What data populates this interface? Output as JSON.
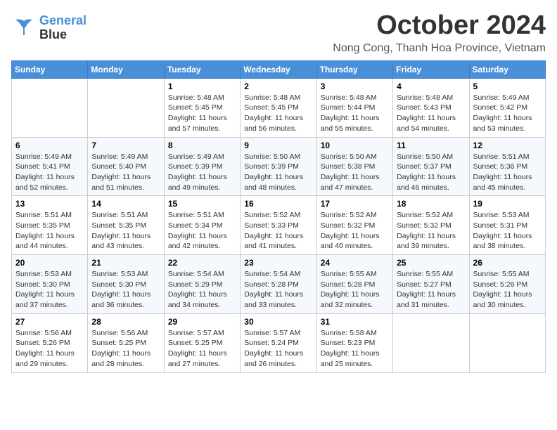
{
  "header": {
    "logo_line1": "General",
    "logo_line2": "Blue",
    "month": "October 2024",
    "location": "Nong Cong, Thanh Hoa Province, Vietnam"
  },
  "weekdays": [
    "Sunday",
    "Monday",
    "Tuesday",
    "Wednesday",
    "Thursday",
    "Friday",
    "Saturday"
  ],
  "weeks": [
    [
      {
        "day": "",
        "info": ""
      },
      {
        "day": "",
        "info": ""
      },
      {
        "day": "1",
        "info": "Sunrise: 5:48 AM\nSunset: 5:45 PM\nDaylight: 11 hours and 57 minutes."
      },
      {
        "day": "2",
        "info": "Sunrise: 5:48 AM\nSunset: 5:45 PM\nDaylight: 11 hours and 56 minutes."
      },
      {
        "day": "3",
        "info": "Sunrise: 5:48 AM\nSunset: 5:44 PM\nDaylight: 11 hours and 55 minutes."
      },
      {
        "day": "4",
        "info": "Sunrise: 5:48 AM\nSunset: 5:43 PM\nDaylight: 11 hours and 54 minutes."
      },
      {
        "day": "5",
        "info": "Sunrise: 5:49 AM\nSunset: 5:42 PM\nDaylight: 11 hours and 53 minutes."
      }
    ],
    [
      {
        "day": "6",
        "info": "Sunrise: 5:49 AM\nSunset: 5:41 PM\nDaylight: 11 hours and 52 minutes."
      },
      {
        "day": "7",
        "info": "Sunrise: 5:49 AM\nSunset: 5:40 PM\nDaylight: 11 hours and 51 minutes."
      },
      {
        "day": "8",
        "info": "Sunrise: 5:49 AM\nSunset: 5:39 PM\nDaylight: 11 hours and 49 minutes."
      },
      {
        "day": "9",
        "info": "Sunrise: 5:50 AM\nSunset: 5:39 PM\nDaylight: 11 hours and 48 minutes."
      },
      {
        "day": "10",
        "info": "Sunrise: 5:50 AM\nSunset: 5:38 PM\nDaylight: 11 hours and 47 minutes."
      },
      {
        "day": "11",
        "info": "Sunrise: 5:50 AM\nSunset: 5:37 PM\nDaylight: 11 hours and 46 minutes."
      },
      {
        "day": "12",
        "info": "Sunrise: 5:51 AM\nSunset: 5:36 PM\nDaylight: 11 hours and 45 minutes."
      }
    ],
    [
      {
        "day": "13",
        "info": "Sunrise: 5:51 AM\nSunset: 5:35 PM\nDaylight: 11 hours and 44 minutes."
      },
      {
        "day": "14",
        "info": "Sunrise: 5:51 AM\nSunset: 5:35 PM\nDaylight: 11 hours and 43 minutes."
      },
      {
        "day": "15",
        "info": "Sunrise: 5:51 AM\nSunset: 5:34 PM\nDaylight: 11 hours and 42 minutes."
      },
      {
        "day": "16",
        "info": "Sunrise: 5:52 AM\nSunset: 5:33 PM\nDaylight: 11 hours and 41 minutes."
      },
      {
        "day": "17",
        "info": "Sunrise: 5:52 AM\nSunset: 5:32 PM\nDaylight: 11 hours and 40 minutes."
      },
      {
        "day": "18",
        "info": "Sunrise: 5:52 AM\nSunset: 5:32 PM\nDaylight: 11 hours and 39 minutes."
      },
      {
        "day": "19",
        "info": "Sunrise: 5:53 AM\nSunset: 5:31 PM\nDaylight: 11 hours and 38 minutes."
      }
    ],
    [
      {
        "day": "20",
        "info": "Sunrise: 5:53 AM\nSunset: 5:30 PM\nDaylight: 11 hours and 37 minutes."
      },
      {
        "day": "21",
        "info": "Sunrise: 5:53 AM\nSunset: 5:30 PM\nDaylight: 11 hours and 36 minutes."
      },
      {
        "day": "22",
        "info": "Sunrise: 5:54 AM\nSunset: 5:29 PM\nDaylight: 11 hours and 34 minutes."
      },
      {
        "day": "23",
        "info": "Sunrise: 5:54 AM\nSunset: 5:28 PM\nDaylight: 11 hours and 33 minutes."
      },
      {
        "day": "24",
        "info": "Sunrise: 5:55 AM\nSunset: 5:28 PM\nDaylight: 11 hours and 32 minutes."
      },
      {
        "day": "25",
        "info": "Sunrise: 5:55 AM\nSunset: 5:27 PM\nDaylight: 11 hours and 31 minutes."
      },
      {
        "day": "26",
        "info": "Sunrise: 5:55 AM\nSunset: 5:26 PM\nDaylight: 11 hours and 30 minutes."
      }
    ],
    [
      {
        "day": "27",
        "info": "Sunrise: 5:56 AM\nSunset: 5:26 PM\nDaylight: 11 hours and 29 minutes."
      },
      {
        "day": "28",
        "info": "Sunrise: 5:56 AM\nSunset: 5:25 PM\nDaylight: 11 hours and 28 minutes."
      },
      {
        "day": "29",
        "info": "Sunrise: 5:57 AM\nSunset: 5:25 PM\nDaylight: 11 hours and 27 minutes."
      },
      {
        "day": "30",
        "info": "Sunrise: 5:57 AM\nSunset: 5:24 PM\nDaylight: 11 hours and 26 minutes."
      },
      {
        "day": "31",
        "info": "Sunrise: 5:58 AM\nSunset: 5:23 PM\nDaylight: 11 hours and 25 minutes."
      },
      {
        "day": "",
        "info": ""
      },
      {
        "day": "",
        "info": ""
      }
    ]
  ]
}
